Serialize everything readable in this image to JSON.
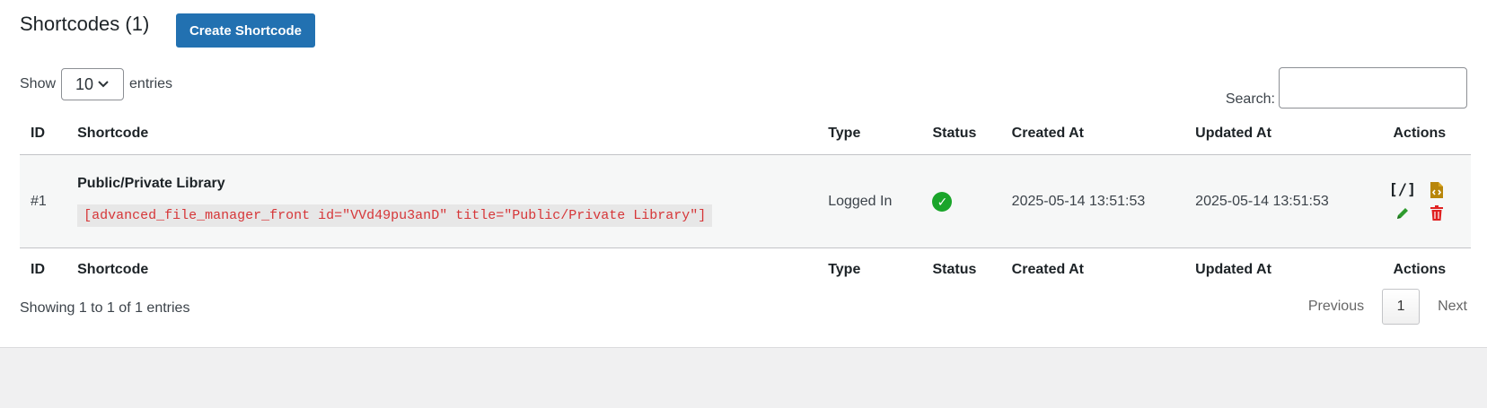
{
  "header": {
    "title": "Shortcodes (1)",
    "create_label": "Create Shortcode"
  },
  "length": {
    "show_label": "Show",
    "value": "10",
    "entries_label": "entries"
  },
  "search": {
    "label": "Search:",
    "value": ""
  },
  "columns": [
    "ID",
    "Shortcode",
    "Type",
    "Status",
    "Created At",
    "Updated At",
    "Actions"
  ],
  "rows": [
    {
      "id": "#1",
      "title": "Public/Private Library",
      "shortcode": "[advanced_file_manager_front id=\"VVd49pu3anD\" title=\"Public/Private Library\"]",
      "type": "Logged In",
      "status": "active",
      "created": "2025-05-14 13:51:53",
      "updated": "2025-05-14 13:51:53"
    }
  ],
  "footer": {
    "info": "Showing 1 to 1 of 1 entries",
    "previous": "Previous",
    "page": "1",
    "next": "Next"
  },
  "icons": {
    "status": "check-circle-icon",
    "copy": "shortcode-brackets-icon",
    "php": "php-code-file-icon",
    "edit": "pencil-icon",
    "delete": "trash-icon"
  },
  "colors": {
    "primary": "#2271b1",
    "success": "#1aa52a",
    "danger": "#d63638",
    "code_text": "#d63638"
  }
}
